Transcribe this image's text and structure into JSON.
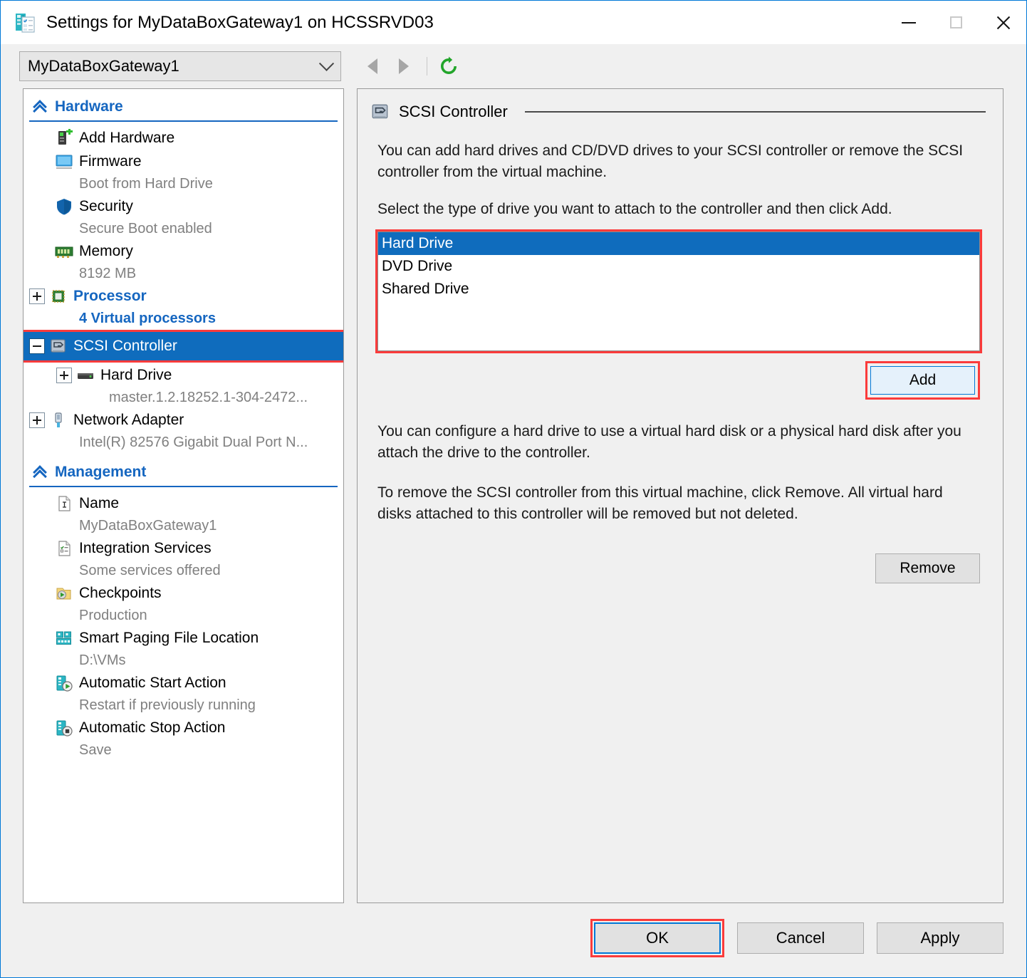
{
  "window": {
    "title": "Settings for MyDataBoxGateway1 on HCSSRVD03",
    "icon": "settings-vm-icon",
    "controls": {
      "minimize": "minimize-icon",
      "maximize": "maximize-icon",
      "close": "close-icon"
    }
  },
  "toolbar": {
    "vm_selector_value": "MyDataBoxGateway1",
    "back": "back-arrow-icon",
    "forward": "forward-arrow-icon",
    "refresh": "refresh-icon"
  },
  "sidebar": {
    "sections": [
      {
        "title": "Hardware",
        "items": [
          {
            "label": "Add Hardware",
            "sub": "",
            "icon": "add-hardware-icon",
            "expander": "none",
            "selected": false,
            "link": false
          },
          {
            "label": "Firmware",
            "sub": "Boot from Hard Drive",
            "icon": "firmware-icon",
            "expander": "none",
            "selected": false,
            "link": false
          },
          {
            "label": "Security",
            "sub": "Secure Boot enabled",
            "icon": "security-icon",
            "expander": "none",
            "selected": false,
            "link": false
          },
          {
            "label": "Memory",
            "sub": "8192 MB",
            "icon": "memory-icon",
            "expander": "none",
            "selected": false,
            "link": false
          },
          {
            "label": "Processor",
            "sub": "4 Virtual processors",
            "icon": "processor-icon",
            "expander": "plus",
            "selected": false,
            "link": true
          },
          {
            "label": "SCSI Controller",
            "sub": "",
            "icon": "scsi-controller-icon",
            "expander": "minus",
            "selected": true,
            "link": false
          },
          {
            "label": "Hard Drive",
            "sub": "master.1.2.18252.1-304-2472...",
            "icon": "hard-drive-icon",
            "expander": "plus",
            "selected": false,
            "link": false,
            "indent": true
          },
          {
            "label": "Network Adapter",
            "sub": "Intel(R) 82576 Gigabit Dual Port N...",
            "icon": "network-adapter-icon",
            "expander": "plus",
            "selected": false,
            "link": false
          }
        ]
      },
      {
        "title": "Management",
        "items": [
          {
            "label": "Name",
            "sub": "MyDataBoxGateway1",
            "icon": "name-icon",
            "expander": "none",
            "selected": false,
            "link": false
          },
          {
            "label": "Integration Services",
            "sub": "Some services offered",
            "icon": "integration-services-icon",
            "expander": "none",
            "selected": false,
            "link": false
          },
          {
            "label": "Checkpoints",
            "sub": "Production",
            "icon": "checkpoints-icon",
            "expander": "none",
            "selected": false,
            "link": false
          },
          {
            "label": "Smart Paging File Location",
            "sub": "D:\\VMs",
            "icon": "smart-paging-icon",
            "expander": "none",
            "selected": false,
            "link": false
          },
          {
            "label": "Automatic Start Action",
            "sub": "Restart if previously running",
            "icon": "auto-start-icon",
            "expander": "none",
            "selected": false,
            "link": false
          },
          {
            "label": "Automatic Stop Action",
            "sub": "Save",
            "icon": "auto-stop-icon",
            "expander": "none",
            "selected": false,
            "link": false
          }
        ]
      }
    ]
  },
  "main": {
    "header_title": "SCSI Controller",
    "header_icon": "scsi-controller-icon",
    "paragraph1": "You can add hard drives and CD/DVD drives to your SCSI controller or remove the SCSI controller from the virtual machine.",
    "paragraph2": "Select the type of drive you want to attach to the controller and then click Add.",
    "drive_types": [
      {
        "label": "Hard Drive",
        "selected": true
      },
      {
        "label": "DVD Drive",
        "selected": false
      },
      {
        "label": "Shared Drive",
        "selected": false
      }
    ],
    "add_label": "Add",
    "paragraph3": "You can configure a hard drive to use a virtual hard disk or a physical hard disk after you attach the drive to the controller.",
    "paragraph4": "To remove the SCSI controller from this virtual machine, click Remove. All virtual hard disks attached to this controller will be removed but not deleted.",
    "remove_label": "Remove"
  },
  "footer": {
    "ok_label": "OK",
    "cancel_label": "Cancel",
    "apply_label": "Apply"
  },
  "colors": {
    "accent_blue": "#0f6cbd",
    "link_blue": "#1566c0",
    "highlight_red": "#fb3b3b",
    "window_border": "#0078d7",
    "dialog_bg": "#f0f0f0"
  }
}
